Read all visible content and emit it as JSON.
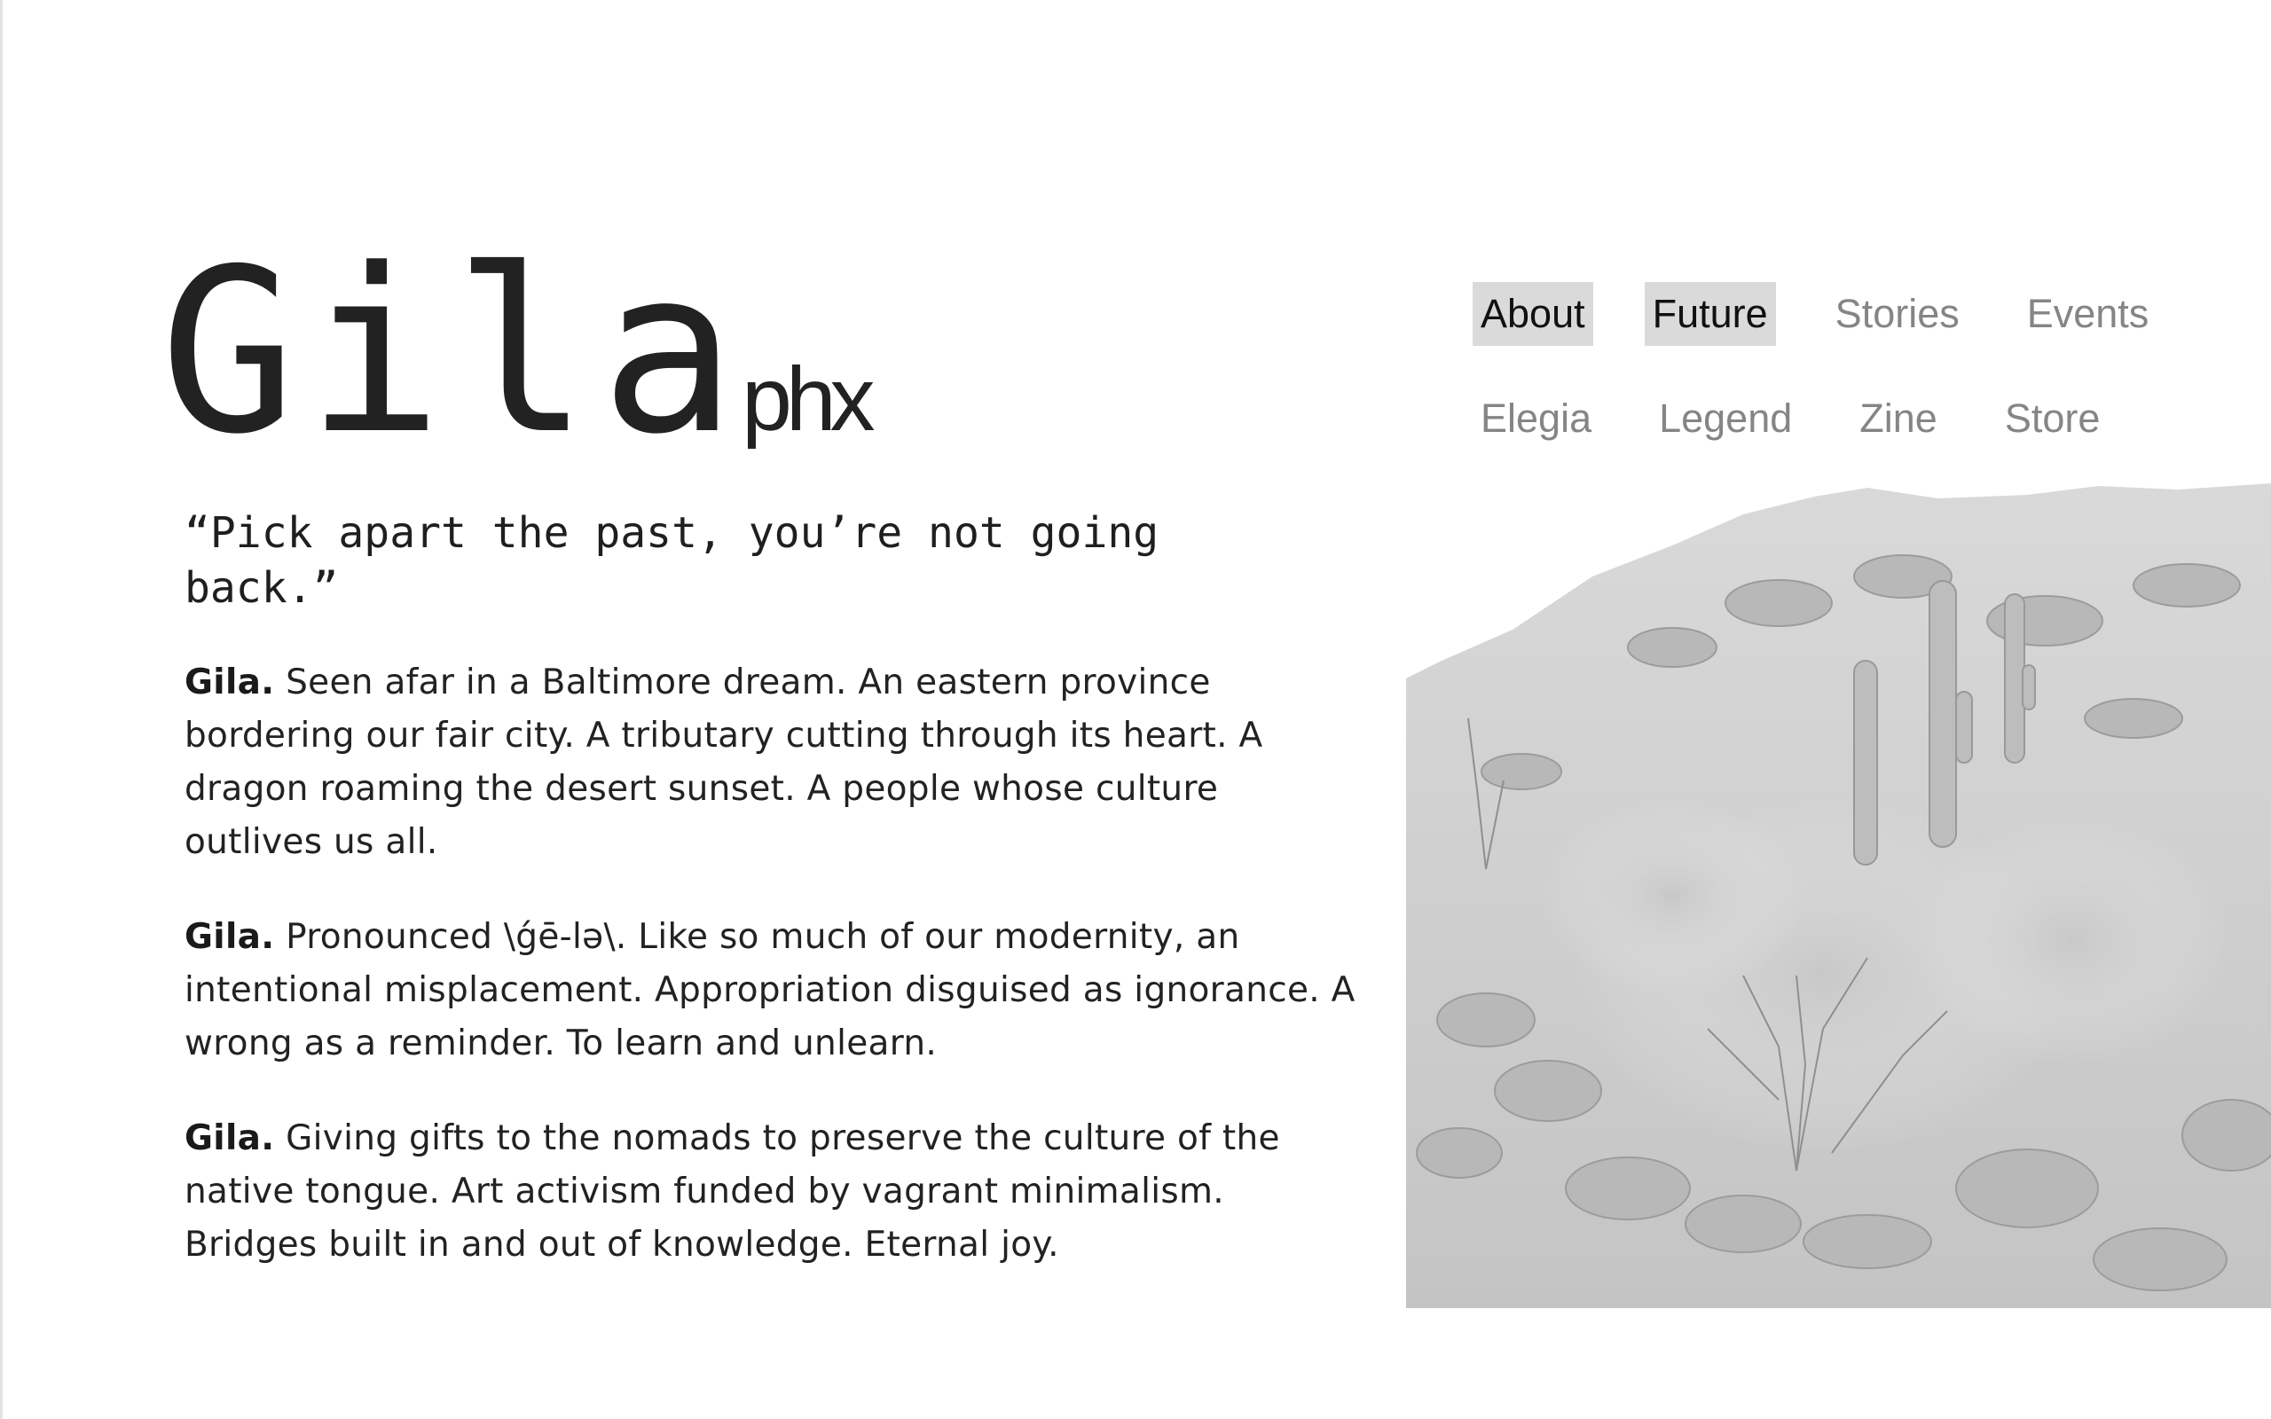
{
  "brand": {
    "name": "Gila",
    "suffix": "phx"
  },
  "nav": {
    "row1": [
      {
        "label": "About",
        "active": true
      },
      {
        "label": "Future",
        "active": true
      },
      {
        "label": "Stories",
        "active": false
      },
      {
        "label": "Events",
        "active": false
      }
    ],
    "row2": [
      {
        "label": "Elegia",
        "active": false
      },
      {
        "label": "Legend",
        "active": false
      },
      {
        "label": "Zine",
        "active": false
      },
      {
        "label": "Store",
        "active": false
      }
    ]
  },
  "quote": "“Pick apart the past, you’re not going back.”",
  "paragraphs": [
    {
      "lead": "Gila.",
      "text": "Seen afar in a Baltimore dream. An eastern province bordering our fair city. A tributary cutting through its heart. A dragon roaming the desert sunset. A people whose culture outlives us all."
    },
    {
      "lead": "Gila.",
      "text": "Pronounced \\ǵē-lə\\. Like so much of our modernity, an intentional misplacement. Appropriation disguised as ignorance. A wrong as a reminder. To learn and unlearn."
    },
    {
      "lead": "Gila.",
      "text": "Giving gifts to the nomads to preserve the culture of the native tongue. Art activism funded by vagrant minimalism. Bridges built in and out of knowledge. Eternal joy."
    }
  ],
  "colors": {
    "text": "#1f1f1f",
    "nav_inactive": "#858585",
    "nav_active_bg": "#dadada",
    "background": "#ffffff"
  }
}
